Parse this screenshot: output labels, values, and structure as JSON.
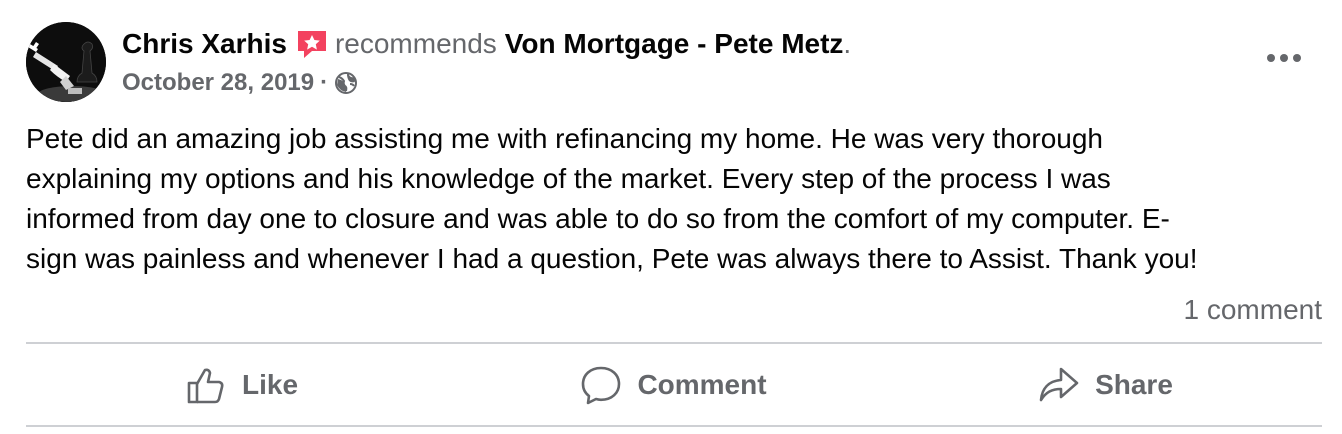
{
  "post": {
    "author": "Chris Xarhis",
    "recommend_icon": "recommend-star-badge-icon",
    "recommends_text": "recommends",
    "page_name": "Von Mortgage - Pete Metz",
    "period": ".",
    "date": "October 28, 2019",
    "date_separator": "·",
    "privacy_icon": "globe-icon",
    "more_icon": "more-options-icon",
    "body_lines": [
      "Pete did an amazing job assisting me with refinancing my home. He was very thorough",
      "explaining my options and his knowledge of the market. Every step of the process I was",
      "informed from day one to closure and was able to do so from the comfort of my computer. E-",
      "sign was painless and whenever I had a question, Pete was always there to Assist. Thank you!"
    ],
    "comment_count": "1 comment"
  },
  "actions": {
    "like": {
      "label": "Like",
      "icon": "thumbs-up-icon"
    },
    "comment": {
      "label": "Comment",
      "icon": "speech-bubble-icon"
    },
    "share": {
      "label": "Share",
      "icon": "share-arrow-icon"
    }
  },
  "colors": {
    "primary_text": "#050505",
    "secondary_text": "#65676b",
    "divider": "#ced0d4",
    "recommend_badge": "#f3425f"
  }
}
